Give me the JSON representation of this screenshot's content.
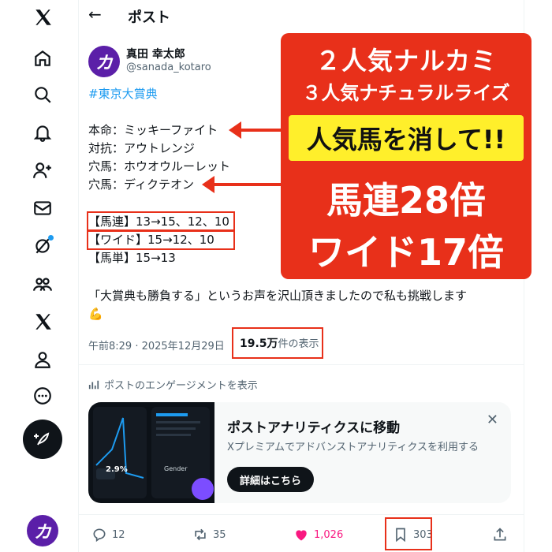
{
  "header": {
    "title": "ポスト"
  },
  "author": {
    "name": "真田 幸太郎",
    "handle": "@sanada_kotaro",
    "avatar_glyph": "カ"
  },
  "tweet": {
    "hashtag": "#東京大賞典",
    "picks": [
      "本命：ミッキーファイト",
      "対抗：アウトレンジ",
      "穴馬：ホウオウルーレット",
      "穴馬：ディクテオン"
    ],
    "bets": [
      "【馬連】13→15、12、10",
      "【ワイド】15→12、10",
      "【馬単】15→13"
    ],
    "body": "「大賞典も勝負する」というお声を沢山頂きましたので私も挑戦します",
    "emoji": "💪"
  },
  "meta": {
    "timestamp": "午前8:29 · 2025年12月29日",
    "views_count": "19.5万",
    "views_suffix": "件の表示"
  },
  "engagement_link": "ポストのエンゲージメントを表示",
  "analytics_card": {
    "title": "ポストアナリティクスに移動",
    "subtitle": "Xプレミアムでアドバンストアナリティクスを利用する",
    "button": "詳細はこちら",
    "preview_stat_1": "2.9%",
    "preview_stat_2": "Gender"
  },
  "actions": {
    "replies": "12",
    "reposts": "35",
    "likes": "1,026",
    "bookmarks": "303"
  },
  "promo": {
    "line1": "２人気ナルカミ",
    "line2": "３人気ナチュラルライズ",
    "line3": "人気馬を消して!!",
    "line4": "馬連28倍",
    "line5": "ワイド17倍"
  },
  "colors": {
    "accent_red": "#e8301a",
    "highlight_yellow": "#ffef2b",
    "link_blue": "#1d9bf0",
    "like_pink": "#f91880",
    "brand_purple": "#5b1fa8"
  }
}
